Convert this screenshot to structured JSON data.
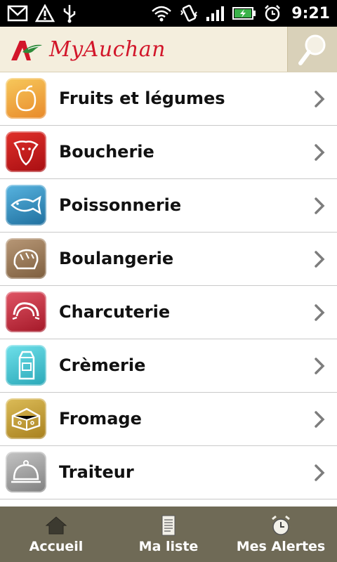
{
  "status_bar": {
    "time": "9:21",
    "icons": [
      "gmail-icon",
      "alert-icon",
      "usb-icon",
      "wifi-icon",
      "vibrate-icon",
      "signal-icon",
      "battery-charging-icon",
      "alarm-icon"
    ]
  },
  "header": {
    "brand_name": "MyAuchan",
    "logo_color": "#d2162a",
    "search_icon": "search-icon"
  },
  "categories": [
    {
      "label": "Fruits et légumes",
      "icon": "fruits-icon",
      "color": "#e89a2a"
    },
    {
      "label": "Boucherie",
      "icon": "cow-icon",
      "color": "#c01818"
    },
    {
      "label": "Poissonnerie",
      "icon": "fish-icon",
      "color": "#2f8ec0"
    },
    {
      "label": "Boulangerie",
      "icon": "bread-icon",
      "color": "#9b7a55"
    },
    {
      "label": "Charcuterie",
      "icon": "sausage-icon",
      "color": "#c43040"
    },
    {
      "label": "Crèmerie",
      "icon": "milk-carton-icon",
      "color": "#3cbfcf"
    },
    {
      "label": "Fromage",
      "icon": "cheese-icon",
      "color": "#c8a030"
    },
    {
      "label": "Traiteur",
      "icon": "cloche-icon",
      "color": "#9a9a9a"
    }
  ],
  "bottom_nav": [
    {
      "label": "Accueil",
      "icon": "home-icon"
    },
    {
      "label": "Ma liste",
      "icon": "list-icon"
    },
    {
      "label": "Mes Alertes",
      "icon": "alarm-clock-icon"
    }
  ]
}
